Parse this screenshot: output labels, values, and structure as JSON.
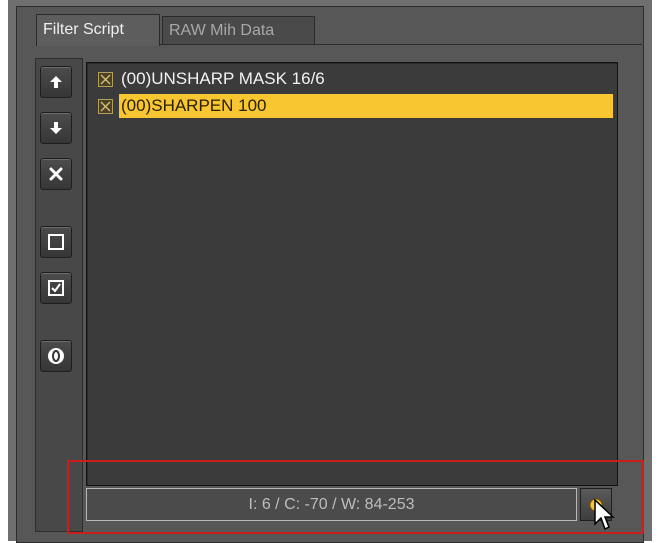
{
  "tabs": [
    {
      "label": "Filter Script",
      "active": true
    },
    {
      "label": "RAW Mih Data",
      "active": false
    }
  ],
  "toolbar": {
    "buttons": [
      {
        "icon": "arrow-up-icon"
      },
      {
        "icon": "arrow-down-icon"
      },
      {
        "icon": "delete-x-icon"
      },
      {
        "icon": "uncheck-all-icon"
      },
      {
        "icon": "check-all-icon"
      },
      {
        "icon": "zero-icon"
      }
    ]
  },
  "filters": [
    {
      "label": "(00)UNSHARP MASK 16/6",
      "checked": true,
      "selected": false
    },
    {
      "label": "(00)SHARPEN 100",
      "checked": true,
      "selected": true
    }
  ],
  "status": {
    "text": "I: 6 / C: -70 / W: 84-253",
    "button_icon": "yellow-circle-icon"
  },
  "colors": {
    "selection": "#f8c630",
    "highlight_outline": "#cc1d1d"
  }
}
